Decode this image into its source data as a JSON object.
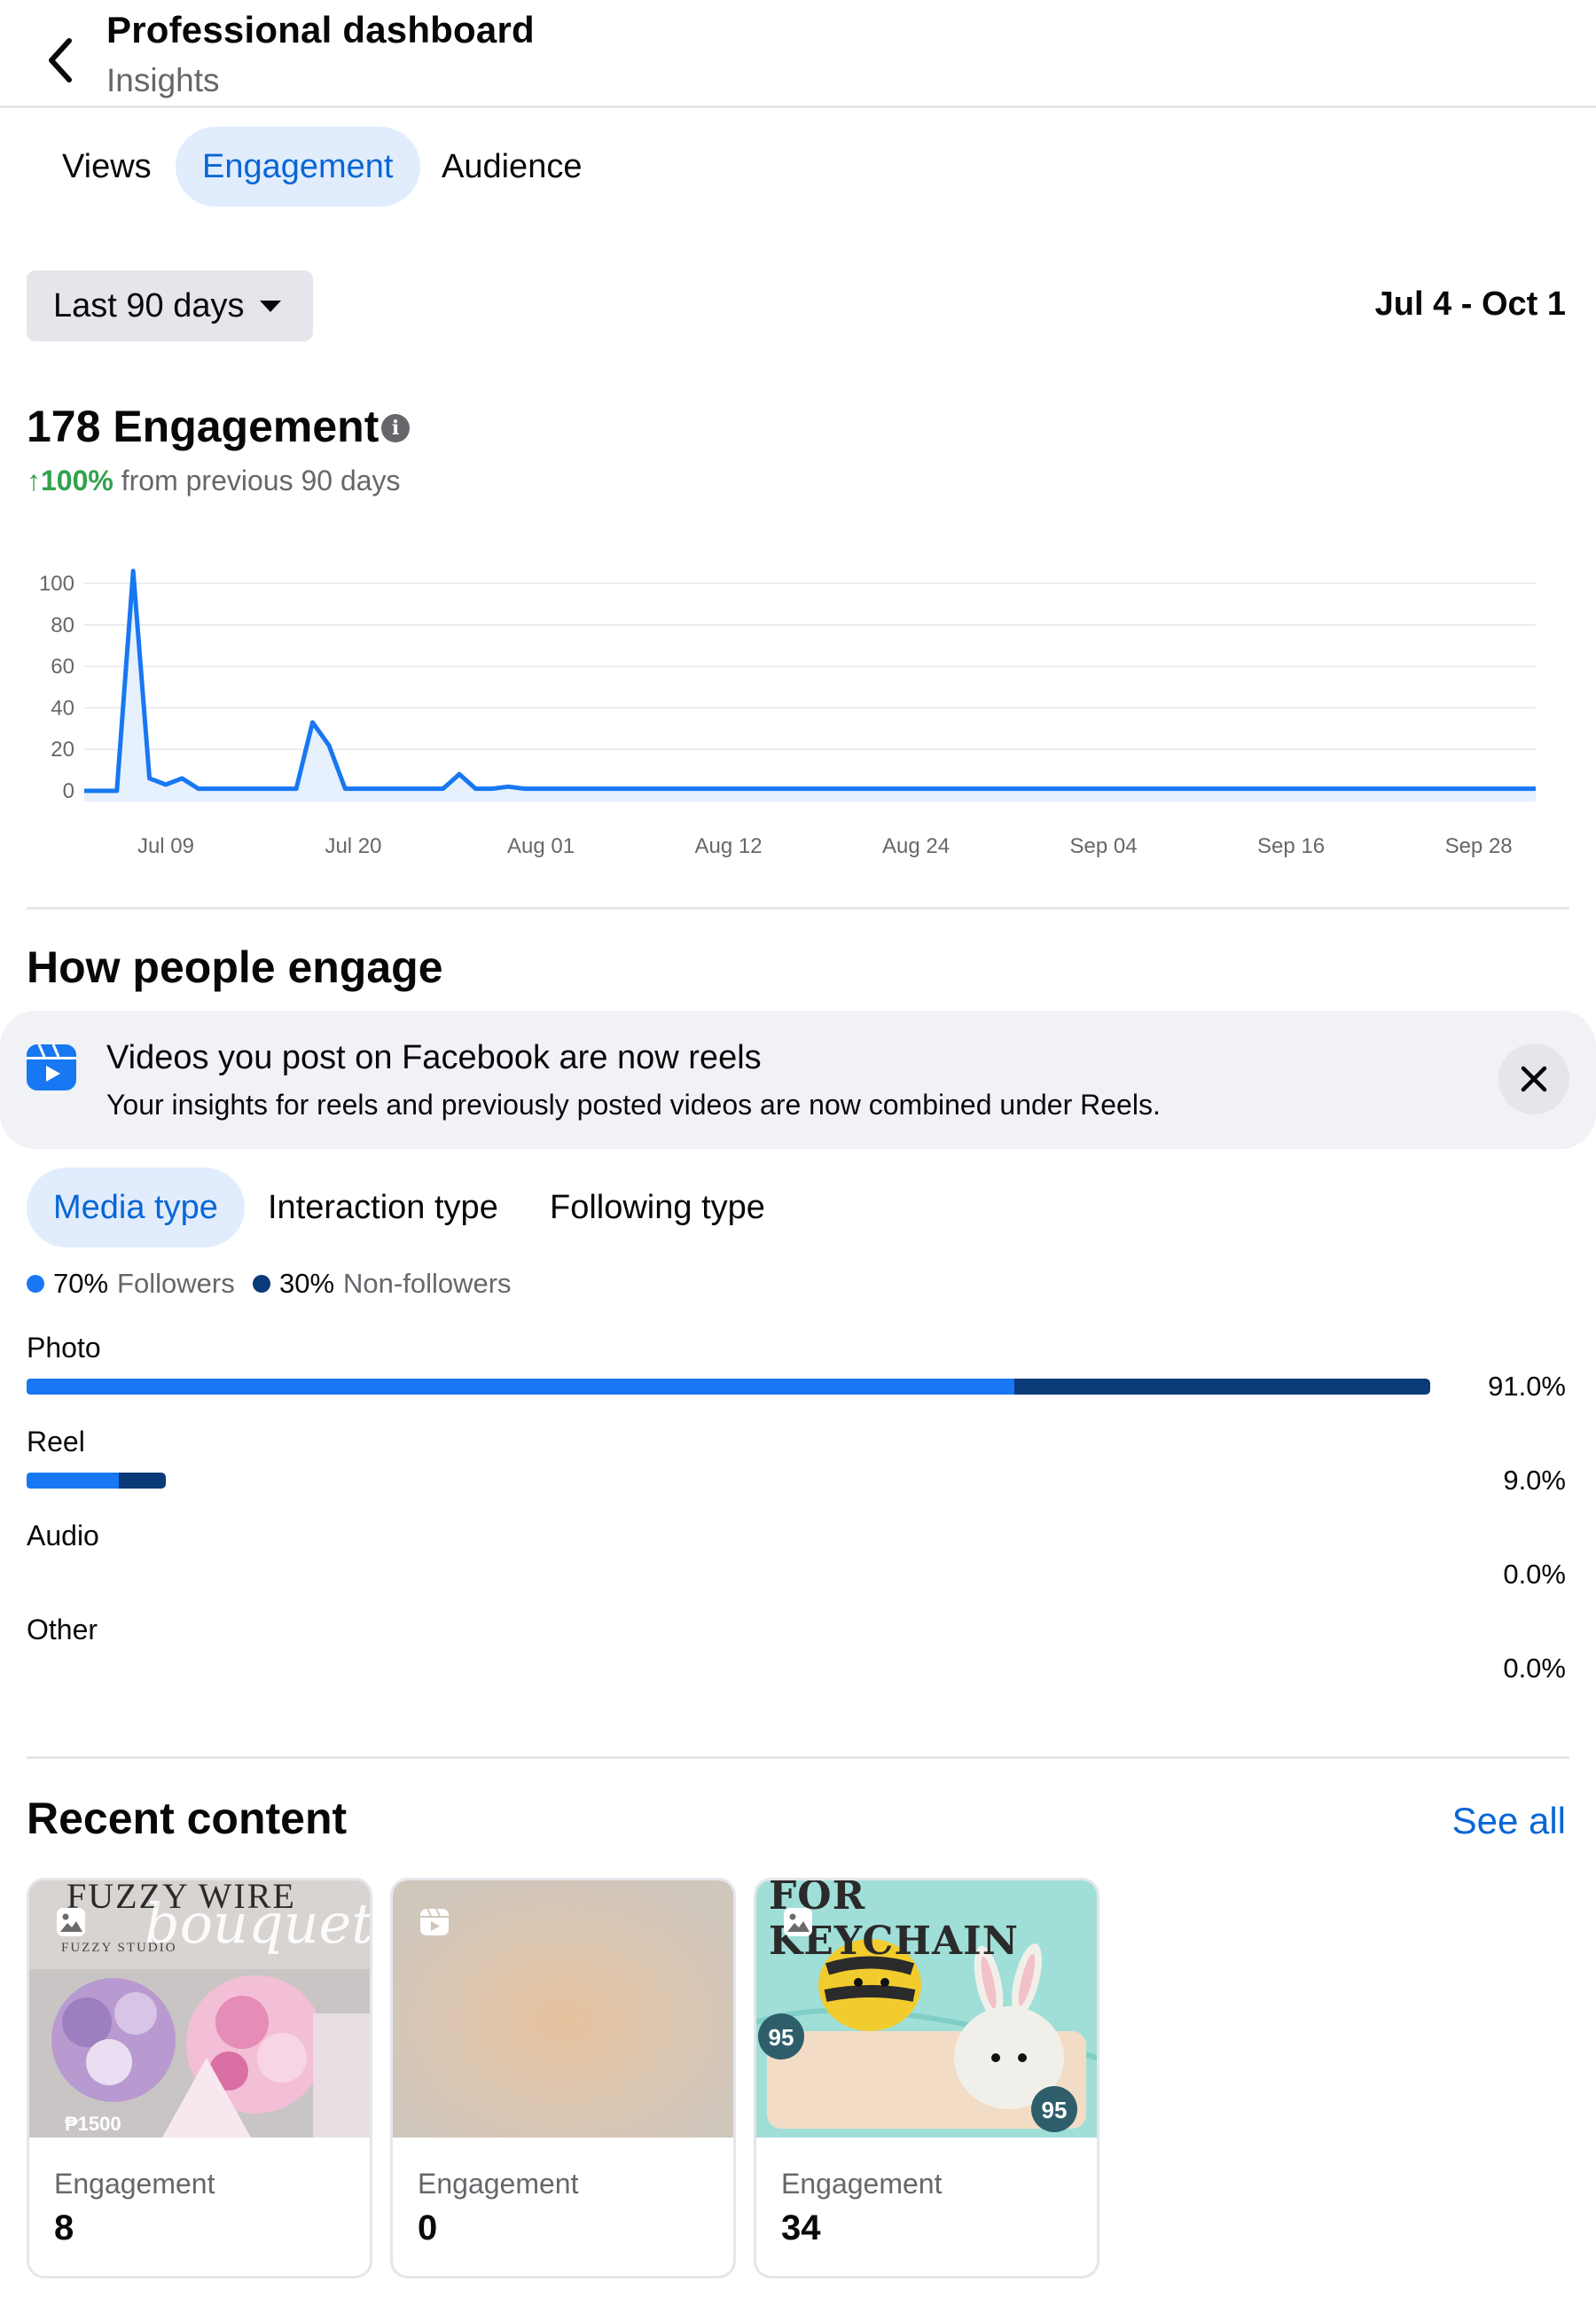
{
  "header": {
    "title": "Professional dashboard",
    "subtitle": "Insights"
  },
  "tabs": [
    {
      "label": "Views"
    },
    {
      "label": "Engagement",
      "active": true
    },
    {
      "label": "Audience"
    }
  ],
  "filter": {
    "range_label": "Last 90 days",
    "date_range": "Jul 4 - Oct 1"
  },
  "summary": {
    "title": "178 Engagement",
    "change_arrow": "↑",
    "change_pct": "100%",
    "change_text": " from previous 90 days"
  },
  "chart_data": {
    "type": "area",
    "y_ticks": [
      "100",
      "80",
      "60",
      "40",
      "20",
      "0"
    ],
    "ylim": [
      0,
      110
    ],
    "x_tick_labels": [
      "Jul 09",
      "Jul 20",
      "Aug 01",
      "Aug 12",
      "Aug 24",
      "Sep 04",
      "Sep 16",
      "Sep 28"
    ],
    "x": [
      "Jul 04",
      "Jul 05",
      "Jul 06",
      "Jul 07",
      "Jul 08",
      "Jul 09",
      "Jul 10",
      "Jul 11",
      "Jul 12",
      "Jul 13",
      "Jul 14",
      "Jul 15",
      "Jul 16",
      "Jul 17",
      "Jul 18",
      "Jul 19",
      "Jul 20",
      "Jul 21",
      "Jul 22",
      "Jul 23",
      "Jul 24",
      "Jul 25",
      "Jul 26",
      "Jul 27",
      "Jul 28",
      "Jul 29",
      "Jul 30",
      "Jul 31",
      "Aug 01",
      "Aug 02",
      "Aug 03",
      "Aug 04",
      "Aug 05",
      "Aug 06",
      "Aug 07",
      "Aug 08",
      "Aug 09",
      "Aug 10",
      "Aug 11",
      "Aug 12",
      "Aug 13",
      "Aug 14",
      "Aug 15",
      "Aug 16",
      "Aug 17",
      "Aug 18",
      "Aug 19",
      "Aug 20",
      "Aug 21",
      "Aug 22",
      "Aug 23",
      "Aug 24",
      "Aug 25",
      "Aug 26",
      "Aug 27",
      "Aug 28",
      "Aug 29",
      "Aug 30",
      "Aug 31",
      "Sep 01",
      "Sep 02",
      "Sep 03",
      "Sep 04",
      "Sep 05",
      "Sep 06",
      "Sep 07",
      "Sep 08",
      "Sep 09",
      "Sep 10",
      "Sep 11",
      "Sep 12",
      "Sep 13",
      "Sep 14",
      "Sep 15",
      "Sep 16",
      "Sep 17",
      "Sep 18",
      "Sep 19",
      "Sep 20",
      "Sep 21",
      "Sep 22",
      "Sep 23",
      "Sep 24",
      "Sep 25",
      "Sep 26",
      "Sep 27",
      "Sep 28",
      "Sep 29",
      "Sep 30",
      "Oct 01"
    ],
    "values": [
      0,
      0,
      0,
      106,
      6,
      3,
      6,
      1,
      1,
      1,
      1,
      1,
      1,
      1,
      33,
      22,
      1,
      1,
      1,
      1,
      1,
      1,
      1,
      8,
      1,
      1,
      2,
      1,
      1,
      1,
      1,
      1,
      1,
      1,
      1,
      1,
      1,
      1,
      1,
      1,
      1,
      1,
      1,
      1,
      1,
      1,
      1,
      1,
      1,
      1,
      1,
      1,
      1,
      1,
      1,
      1,
      1,
      1,
      1,
      1,
      1,
      1,
      1,
      1,
      1,
      1,
      1,
      1,
      1,
      1,
      1,
      1,
      1,
      1,
      1,
      1,
      1,
      1,
      1,
      1,
      1,
      1,
      1,
      1,
      1,
      1,
      1,
      1,
      1,
      1
    ],
    "color": "#1877f2",
    "grid": true
  },
  "engage": {
    "title": "How people engage",
    "notice": {
      "title": "Videos you post on Facebook are now reels",
      "body": "Your insights for reels and previously posted videos are now combined under Reels."
    },
    "subtabs": [
      {
        "label": "Media type",
        "active": true
      },
      {
        "label": "Interaction type"
      },
      {
        "label": "Following type"
      }
    ],
    "legend": [
      {
        "pct": "70%",
        "label": "Followers",
        "color": "#1877f2"
      },
      {
        "pct": "30%",
        "label": "Non-followers",
        "color": "#0a3a77"
      }
    ],
    "bars": [
      {
        "label": "Photo",
        "followers": 0.64,
        "nonfollowers": 0.27,
        "pct": "91.0%"
      },
      {
        "label": "Reel",
        "followers": 0.06,
        "nonfollowers": 0.03,
        "pct": "9.0%"
      },
      {
        "label": "Audio",
        "followers": 0,
        "nonfollowers": 0,
        "pct": "0.0%"
      },
      {
        "label": "Other",
        "followers": 0,
        "nonfollowers": 0,
        "pct": "0.0%"
      }
    ]
  },
  "recent": {
    "title": "Recent content",
    "see_all": "See all",
    "cards": [
      {
        "type_icon": "photo-icon",
        "thumb_text_top": "FUZZY WIRE",
        "thumb_text_script": "bouquet",
        "thumb_text_studio": "FUZZY STUDIO",
        "thumb_price": "₱1500",
        "label": "Engagement",
        "value": "8"
      },
      {
        "type_icon": "reel-icon",
        "label": "Engagement",
        "value": "0"
      },
      {
        "type_icon": "photo-icon",
        "thumb_text_top": "FOR KEYCHAIN",
        "badge1": "95",
        "badge2": "95",
        "label": "Engagement",
        "value": "34"
      }
    ]
  }
}
